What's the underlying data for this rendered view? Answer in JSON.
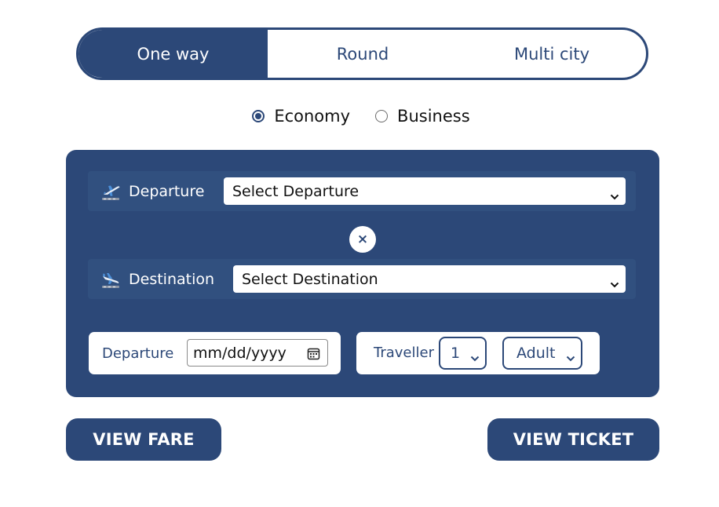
{
  "trip_type": {
    "tabs": [
      {
        "label": "One way",
        "active": true
      },
      {
        "label": "Round",
        "active": false
      },
      {
        "label": "Multi city",
        "active": false
      }
    ]
  },
  "travel_class": {
    "options": [
      {
        "label": "Economy",
        "checked": true
      },
      {
        "label": "Business",
        "checked": false
      }
    ]
  },
  "route": {
    "departure": {
      "label": "Departure",
      "icon": "plane-departure-icon",
      "select_value": "Select Departure"
    },
    "swap_glyph": "×",
    "destination": {
      "label": "Destination",
      "icon": "plane-arrival-icon",
      "select_value": "Select Destination"
    }
  },
  "date": {
    "label": "Departure",
    "placeholder": "mm/dd/yyyy"
  },
  "traveller": {
    "label": "Traveller",
    "count": "1",
    "type": "Adult"
  },
  "actions": {
    "view_fare": "VIEW FARE",
    "view_ticket": "VIEW TICKET"
  },
  "colors": {
    "primary": "#2c4878",
    "row_bg": "#31507f",
    "white": "#ffffff"
  }
}
